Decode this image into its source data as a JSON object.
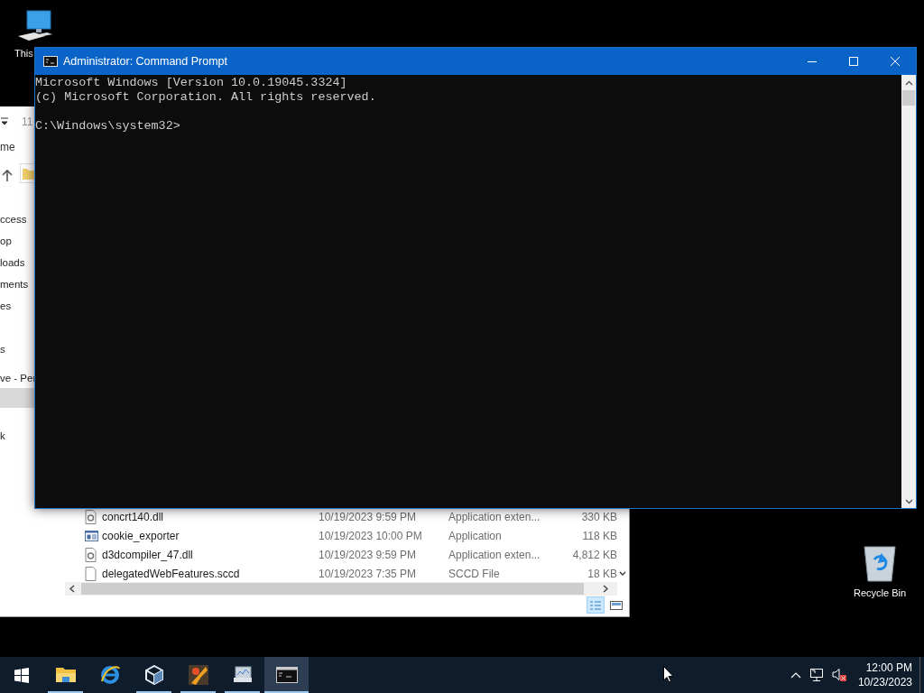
{
  "desktop_icons": [
    {
      "kind": "computer",
      "label": "This"
    },
    {
      "kind": "recycle",
      "label": "Recycle Bin"
    }
  ],
  "explorer": {
    "path_fragment": "11",
    "ribbon_tab": "me",
    "nav_items": [
      {
        "label": "ccess",
        "selected": false
      },
      {
        "label": "op",
        "selected": false
      },
      {
        "label": "loads",
        "selected": false
      },
      {
        "label": "ments",
        "selected": false
      },
      {
        "label": "es",
        "selected": false
      },
      {
        "label": "s",
        "selected": false
      },
      {
        "label": "ve - Per",
        "selected": false
      },
      {
        "selected": true
      },
      {
        "label": "k",
        "selected": false
      }
    ],
    "files": [
      {
        "kind": "dll",
        "name": "concrt140.dll",
        "date": "10/19/2023 9:59 PM",
        "type": "Application exten...",
        "size": "330 KB"
      },
      {
        "kind": "app",
        "name": "cookie_exporter",
        "date": "10/19/2023 10:00 PM",
        "type": "Application",
        "size": "118 KB"
      },
      {
        "kind": "dll",
        "name": "d3dcompiler_47.dll",
        "date": "10/19/2023 9:59 PM",
        "type": "Application exten...",
        "size": "4,812 KB"
      },
      {
        "kind": "file",
        "name": "delegatedWebFeatures.sccd",
        "date": "10/19/2023 7:35 PM",
        "type": "SCCD File",
        "size": "18 KB"
      }
    ],
    "views": [
      {
        "kind": "details",
        "selected": true
      },
      {
        "kind": "tiles",
        "selected": false
      }
    ]
  },
  "cmd": {
    "title": "Administrator: Command Prompt",
    "lines": [
      "Microsoft Windows [Version 10.0.19045.3324]",
      "(c) Microsoft Corporation. All rights reserved."
    ],
    "prompt": "C:\\Windows\\system32>"
  },
  "taskbar": {
    "apps": [
      {
        "kind": "start",
        "running": false,
        "selected": false
      },
      {
        "kind": "explorer",
        "running": true,
        "selected": false
      },
      {
        "kind": "browser",
        "running": false,
        "selected": false
      },
      {
        "kind": "cube",
        "running": true,
        "selected": false
      },
      {
        "kind": "orange",
        "running": true,
        "selected": false
      },
      {
        "kind": "monitor",
        "running": true,
        "selected": false
      },
      {
        "kind": "cmd",
        "running": true,
        "selected": true
      }
    ],
    "time": "12:00 PM",
    "date": "10/23/2023"
  }
}
